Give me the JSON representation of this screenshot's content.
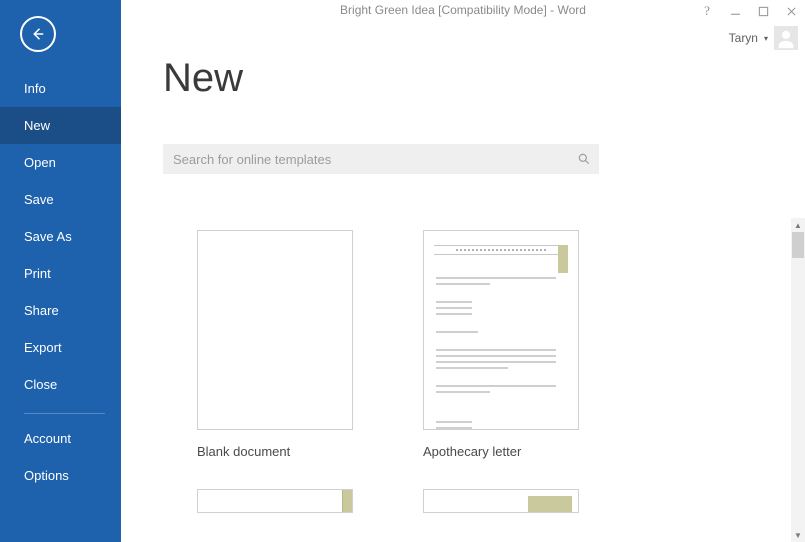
{
  "window": {
    "title": "Bright Green Idea [Compatibility Mode] - Word"
  },
  "user": {
    "name": "Taryn"
  },
  "sidebar": {
    "items": [
      {
        "label": "Info"
      },
      {
        "label": "New"
      },
      {
        "label": "Open"
      },
      {
        "label": "Save"
      },
      {
        "label": "Save As"
      },
      {
        "label": "Print"
      },
      {
        "label": "Share"
      },
      {
        "label": "Export"
      },
      {
        "label": "Close"
      }
    ],
    "footer": [
      {
        "label": "Account"
      },
      {
        "label": "Options"
      }
    ],
    "selected": "New"
  },
  "page": {
    "heading": "New",
    "search_placeholder": "Search for online templates"
  },
  "templates": [
    {
      "label": "Blank document",
      "style": "blank"
    },
    {
      "label": "Apothecary letter",
      "style": "apothecary"
    }
  ]
}
